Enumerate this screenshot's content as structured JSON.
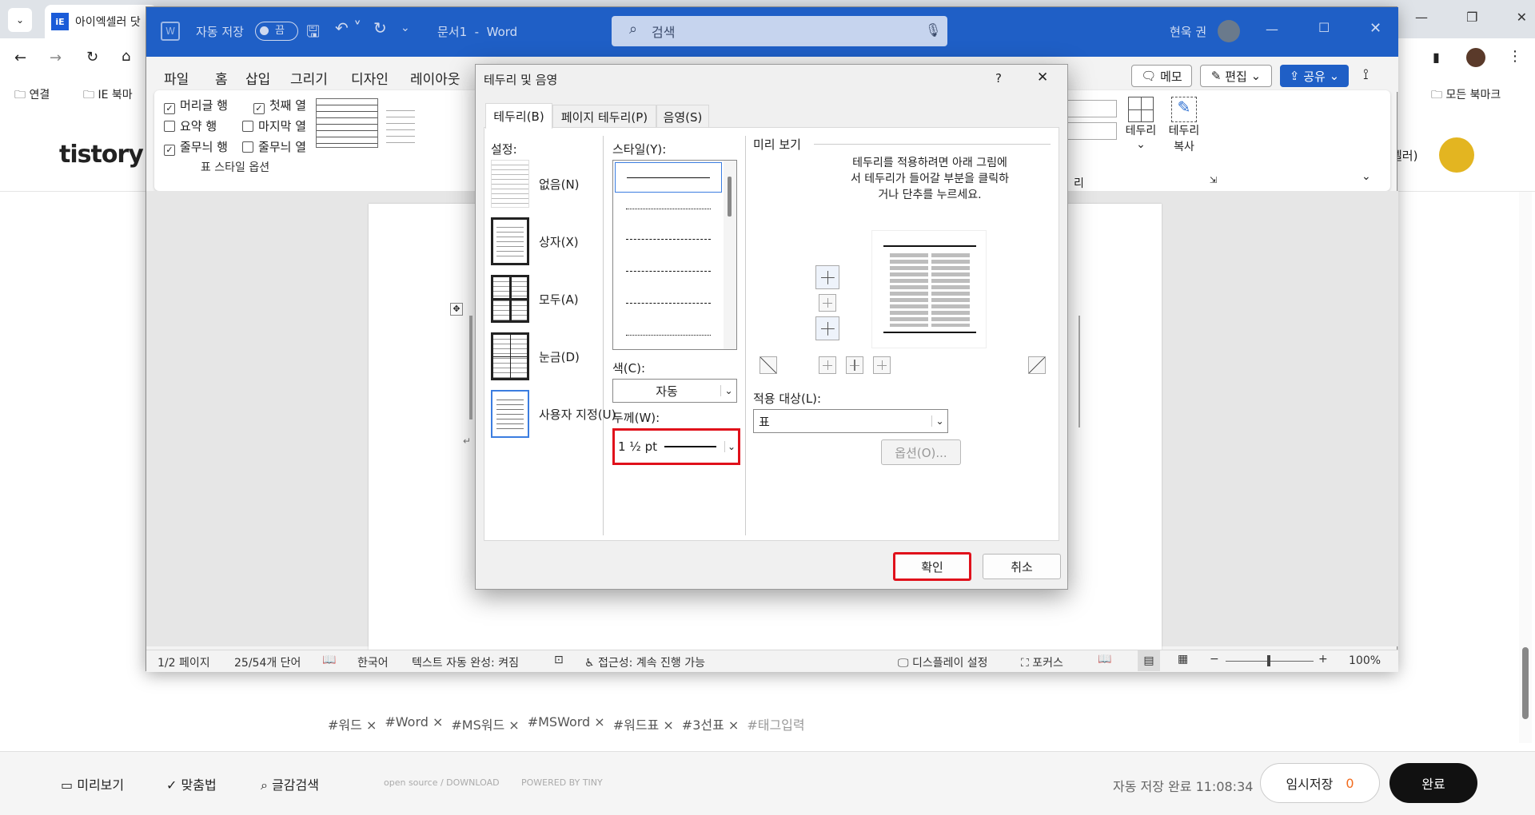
{
  "browser": {
    "tab_title": "아이엑셀러 닷",
    "bookmarks": [
      "연결",
      "IE 북마",
      "모든 북마크"
    ],
    "blog_logo": "tistory",
    "user_suffix": "셀러)"
  },
  "word": {
    "autosave_label": "자동 저장",
    "autosave_state": "끔",
    "doc_title": "문서1  -  Word",
    "search_placeholder": "검색",
    "user_name": "현욱 권",
    "menu": [
      "파일",
      "홈",
      "삽입",
      "그리기",
      "디자인",
      "레이아웃"
    ],
    "memo": "메모",
    "edit": "편집",
    "share": "공유",
    "table_style_options": {
      "header_row": "머리글 행",
      "first_col": "첫째 열",
      "total_row": "요약 행",
      "last_col": "마지막 열",
      "banded_rows": "줄무늬 행",
      "banded_cols": "줄무늬 열",
      "group_label": "표 스타일 옵션"
    },
    "borders_btn": "테두리",
    "border_painter": "테두리 복사",
    "ribbon_group_end": "리",
    "status": {
      "page": "1/2 페이지",
      "words": "25/54개 단어",
      "language": "한국어",
      "autocomplete": "텍스트 자동 완성: 켜짐",
      "accessibility": "접근성: 계속 진행 가능",
      "display": "디스플레이 설정",
      "focus": "포커스",
      "zoom": "100%"
    }
  },
  "dialog": {
    "title": "테두리 및 음영",
    "help": "?",
    "tabs": [
      "테두리(B)",
      "페이지 테두리(P)",
      "음영(S)"
    ],
    "settings_label": "설정:",
    "settings": [
      "없음(N)",
      "상자(X)",
      "모두(A)",
      "눈금(D)",
      "사용자 지정(U)"
    ],
    "style_label": "스타일(Y):",
    "color_label": "색(C):",
    "color_value": "자동",
    "width_label": "두께(W):",
    "width_value": "1 ½ pt",
    "preview_label": "미리 보기",
    "preview_hint": "테두리를 적용하려면 아래 그림에서 테두리가 들어갈 부분을 클릭하거나 단추를 누르세요.",
    "apply_to_label": "적용 대상(L):",
    "apply_to_value": "표",
    "options_btn": "옵션(O)...",
    "ok_btn": "확인",
    "cancel_btn": "취소"
  },
  "blog": {
    "tags": [
      "#워드",
      "#Word",
      "#MS워드",
      "#MSWord",
      "#워드표",
      "#3선표",
      "#태그입력"
    ],
    "bottom": {
      "preview": "미리보기",
      "spell": "맞춤법",
      "search": "글감검색",
      "opensource": "open source / DOWNLOAD",
      "powered": "POWERED BY TINY",
      "autosave": "자동 저장 완료 11:08:34",
      "temp_save": "임시저장",
      "temp_count": "0",
      "done": "완료"
    }
  },
  "colors": {
    "word_blue": "#1f5fc6",
    "highlight_red": "#e0111b",
    "count_orange": "#f26b1d"
  }
}
